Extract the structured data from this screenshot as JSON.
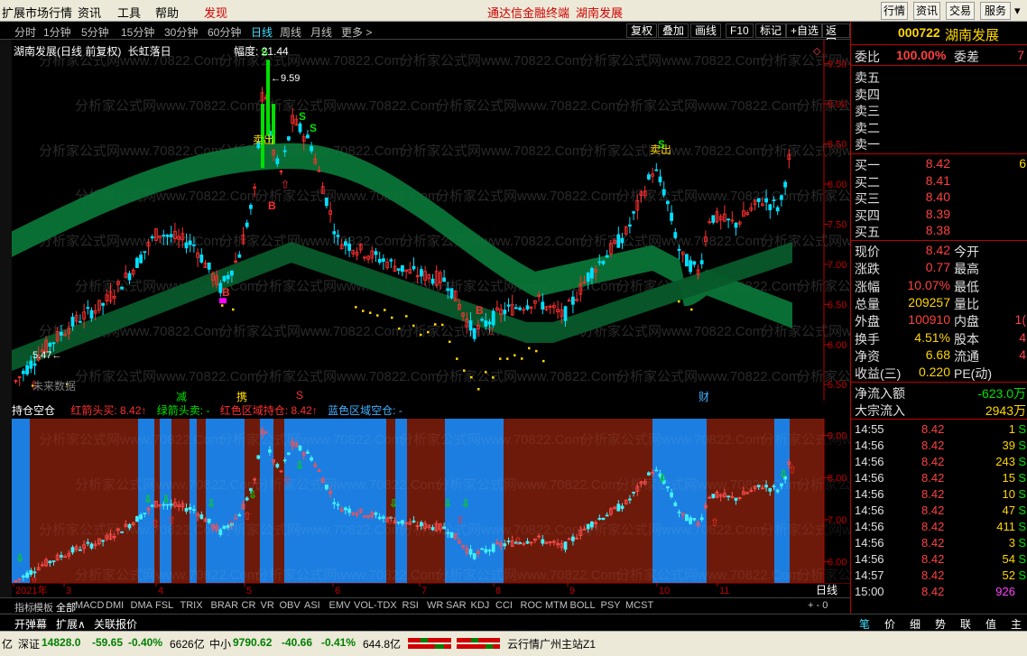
{
  "menubar": {
    "items": [
      "扩展市场行情",
      "资讯",
      "工具",
      "帮助"
    ],
    "featured": "发现",
    "center_link": "通达信金融终端",
    "center_stock": "湖南发展",
    "right_buttons": [
      "行情",
      "资讯",
      "交易",
      "服务"
    ]
  },
  "periodbar": {
    "periods": [
      "分时",
      "1分钟",
      "5分钟",
      "15分钟",
      "30分钟",
      "60分钟",
      "日线",
      "周线",
      "月线",
      "更多 >"
    ],
    "active": "日线",
    "tools": [
      "复权",
      "叠加",
      "画线",
      "F10",
      "标记",
      "+自选",
      "返回"
    ]
  },
  "chart_title": {
    "name": "湖南发展(日线 前复权)",
    "formula": "长虹落日",
    "amp_label": "幅度:",
    "amp_value": "21.44"
  },
  "main_axis": {
    "ticks": [
      "9.50",
      "9.00",
      "8.50",
      "8.00",
      "7.50",
      "7.00",
      "6.50",
      "6.00",
      "5.50"
    ]
  },
  "annotations": {
    "high": "9.59",
    "low": "5.47",
    "sell1": "卖出",
    "sell2": "卖出",
    "b1": "B",
    "b2": "B",
    "b3": "B",
    "future": "未来数据",
    "ev1": "减",
    "ev2": "携",
    "ev3": "S",
    "ev4": "财"
  },
  "sub_legend": {
    "name": "持仓空仓",
    "red_arrow": "红箭头买:",
    "red_arrow_val": "8.42↑",
    "green_arrow": "绿箭头卖:",
    "green_arrow_val": "-",
    "red_zone": "红色区域持仓:",
    "red_zone_val": "8.42↑",
    "blue_zone": "蓝色区域空仓:",
    "blue_zone_val": "-"
  },
  "sub_axis": {
    "ticks": [
      "9.00",
      "8.00",
      "7.00",
      "6.00"
    ]
  },
  "date_axis": {
    "labels": [
      "2021年",
      "3",
      "4",
      "5",
      "6",
      "7",
      "8",
      "9",
      "10",
      "11"
    ],
    "period_label": "日线"
  },
  "indicator_tabs": {
    "fixed": [
      "指标",
      "模板"
    ],
    "active": "全部",
    "items": [
      "MACD",
      "DMI",
      "DMA",
      "FSL",
      "TRIX",
      "BRAR",
      "CR",
      "VR",
      "OBV",
      "ASI",
      "EMV",
      "VOL-TDX",
      "RSI",
      "WR",
      "SAR",
      "KDJ",
      "CCI",
      "ROC",
      "MTM",
      "BOLL",
      "PSY",
      "MCST"
    ]
  },
  "bottombar": {
    "items": [
      "开弹幕",
      "扩展∧",
      "关联报价"
    ]
  },
  "statusbar": {
    "prefix": "亿",
    "sz_name": "深证",
    "sz_value": "14828.0",
    "sz_change": "-59.65",
    "sz_pct": "-0.40%",
    "sz_amount": "6626亿",
    "zx_name": "中小",
    "zx_value": "9790.62",
    "zx_change": "-40.66",
    "zx_pct": "-0.41%",
    "zx_amount": "644.8亿",
    "server": "云行情广州主站Z1"
  },
  "rpanel": {
    "code": "000722",
    "name": "湖南发展",
    "weibi_label": "委比",
    "weibi_value": "100.00%",
    "weicha_label": "委差",
    "weicha_value": "7",
    "sell": [
      {
        "label": "卖五"
      },
      {
        "label": "卖四"
      },
      {
        "label": "卖三"
      },
      {
        "label": "卖二"
      },
      {
        "label": "卖一"
      }
    ],
    "buy": [
      {
        "label": "买一",
        "price": "8.42",
        "vol": "6"
      },
      {
        "label": "买二",
        "price": "8.41",
        "vol": ""
      },
      {
        "label": "买三",
        "price": "8.40",
        "vol": ""
      },
      {
        "label": "买四",
        "price": "8.39",
        "vol": ""
      },
      {
        "label": "买五",
        "price": "8.38",
        "vol": ""
      }
    ],
    "stats": [
      {
        "l": "现价",
        "v": "8.42",
        "vc": "#ff4040",
        "l2": "今开",
        "v2": ""
      },
      {
        "l": "涨跌",
        "v": "0.77",
        "vc": "#ff4040",
        "l2": "最高",
        "v2": ""
      },
      {
        "l": "涨幅",
        "v": "10.07%",
        "vc": "#ff4040",
        "l2": "最低",
        "v2": ""
      },
      {
        "l": "总量",
        "v": "209257",
        "vc": "#ffd700",
        "l2": "量比",
        "v2": ""
      },
      {
        "l": "外盘",
        "v": "100910",
        "vc": "#ff4040",
        "l2": "内盘",
        "v2": "1("
      },
      {
        "l": "换手",
        "v": "4.51%",
        "vc": "#ffd700",
        "l2": "股本",
        "v2": "4"
      },
      {
        "l": "净资",
        "v": "6.68",
        "vc": "#ffd700",
        "l2": "流通",
        "v2": "4"
      },
      {
        "l": "收益(三)",
        "v": "0.220",
        "vc": "#ffd700",
        "l2": "PE(动)",
        "v2": ""
      }
    ],
    "flow": [
      {
        "l": "净流入额",
        "v": "-623.0万",
        "vc": "#00e000"
      },
      {
        "l": "大宗流入",
        "v": "2943万",
        "vc": "#ffd700"
      }
    ],
    "ticks": [
      {
        "t": "14:55",
        "p": "8.42",
        "v": "1",
        "tag": "S",
        "tc": "#00e000"
      },
      {
        "t": "14:56",
        "p": "8.42",
        "v": "39",
        "tag": "S",
        "tc": "#00e000"
      },
      {
        "t": "14:56",
        "p": "8.42",
        "v": "243",
        "tag": "S",
        "tc": "#00e000"
      },
      {
        "t": "14:56",
        "p": "8.42",
        "v": "15",
        "tag": "S",
        "tc": "#00e000"
      },
      {
        "t": "14:56",
        "p": "8.42",
        "v": "10",
        "tag": "S",
        "tc": "#00e000"
      },
      {
        "t": "14:56",
        "p": "8.42",
        "v": "47",
        "tag": "S",
        "tc": "#00e000"
      },
      {
        "t": "14:56",
        "p": "8.42",
        "v": "411",
        "tag": "S",
        "tc": "#00e000"
      },
      {
        "t": "14:56",
        "p": "8.42",
        "v": "3",
        "tag": "S",
        "tc": "#00e000"
      },
      {
        "t": "14:56",
        "p": "8.42",
        "v": "54",
        "tag": "S",
        "tc": "#00e000"
      },
      {
        "t": "14:57",
        "p": "8.42",
        "v": "52",
        "tag": "S",
        "tc": "#00e000"
      },
      {
        "t": "15:00",
        "p": "8.42",
        "v": "926",
        "tag": "",
        "tc": "#ff40ff"
      }
    ],
    "tabs": [
      "笔",
      "价",
      "细",
      "势",
      "联",
      "值",
      "主"
    ],
    "active_tab": "笔"
  },
  "watermark": "分析家公式网www.70822.Com",
  "colors": {
    "up": "#ff3030",
    "down": "#00e0ff",
    "band": "#0a7a3a",
    "zone_red": "#6e1a0a",
    "zone_blue": "#1c7ee0"
  }
}
